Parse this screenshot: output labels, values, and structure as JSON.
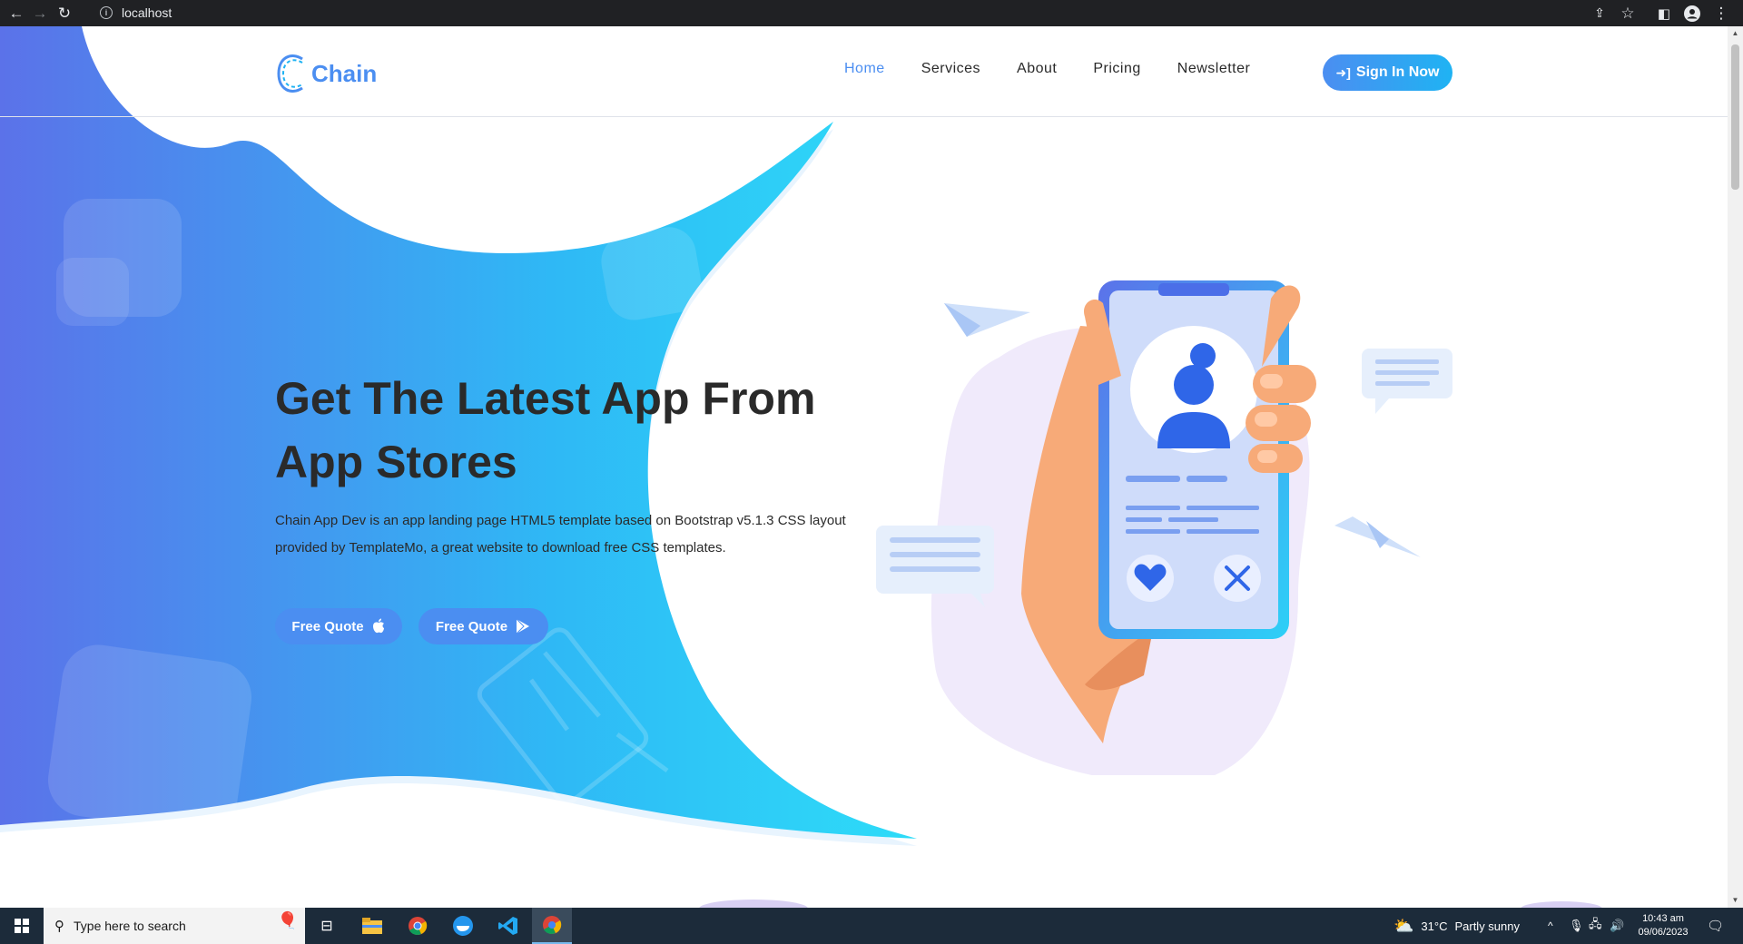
{
  "browser": {
    "url": "localhost"
  },
  "header": {
    "logo_text": "Chain",
    "nav": [
      {
        "label": "Home",
        "active": true
      },
      {
        "label": "Services",
        "active": false
      },
      {
        "label": "About",
        "active": false
      },
      {
        "label": "Pricing",
        "active": false
      },
      {
        "label": "Newsletter",
        "active": false
      }
    ],
    "signin_label": "Sign In Now"
  },
  "hero": {
    "title_line1": "Get The Latest App From",
    "title_line2": "App Stores",
    "desc_line1": "Chain App Dev is an app landing page HTML5 template based on Bootstrap v5.1.3 CSS layout",
    "desc_line2": "provided by TemplateMo, a great website to download free CSS templates.",
    "button_apple_label": "Free Quote",
    "button_play_label": "Free Quote"
  },
  "taskbar": {
    "search_placeholder": "Type here to search",
    "weather_temp": "31°C",
    "weather_desc": "Partly sunny",
    "time": "10:43 am",
    "date": "09/06/2023"
  },
  "colors": {
    "accent": "#4b8ef1",
    "gradient_start": "#5b6ee8",
    "gradient_end": "#2dd0f7",
    "text_dark": "#2a2a2a"
  }
}
